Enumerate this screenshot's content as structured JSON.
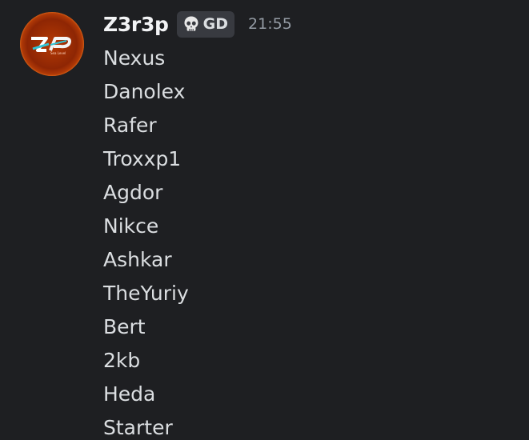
{
  "author": {
    "username": "Z3r3p",
    "avatar": {
      "text": "ZP",
      "subtext": "Sea Level"
    },
    "tag": {
      "icon": "skull-icon",
      "text": "GD"
    },
    "timestamp": "21:55"
  },
  "message": {
    "lines": [
      "Nexus",
      "Danolex",
      "Rafer",
      "Troxxp1",
      "Agdor",
      "Nikce",
      "Ashkar",
      "TheYuriy",
      "Bert",
      "2kb",
      "Heda",
      "Starter"
    ]
  },
  "colors": {
    "background": "#1e1f22",
    "username": "#f2f3f5",
    "text": "#dbdee1",
    "timestamp": "#949ba4",
    "tag_background": "#383a40",
    "avatar_orange": "#e8590b"
  }
}
